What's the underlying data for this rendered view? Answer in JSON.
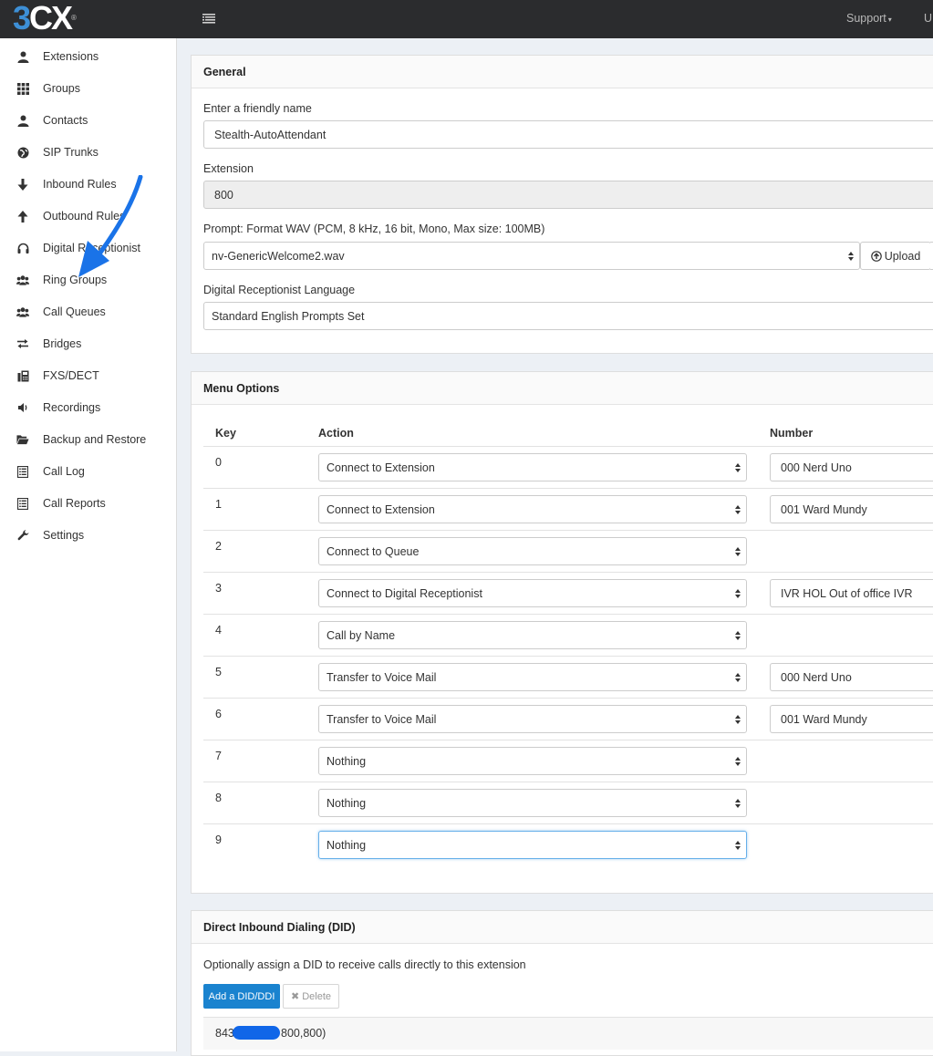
{
  "header": {
    "logo_digit": "3",
    "logo_letters": "CX",
    "logo_reg": "®",
    "support_label": "Support",
    "user_initial": "U"
  },
  "colors": {
    "topbar": "#2b2c2e",
    "logo_blue": "#3d8fd6",
    "primary_button": "#1a83cf",
    "annotation_arrow": "#1a73e8"
  },
  "sidebar": {
    "items": [
      {
        "label": "Extensions",
        "icon": "user-icon"
      },
      {
        "label": "Groups",
        "icon": "grid-icon"
      },
      {
        "label": "Contacts",
        "icon": "user-icon"
      },
      {
        "label": "SIP Trunks",
        "icon": "globe-icon"
      },
      {
        "label": "Inbound Rules",
        "icon": "arrow-down-icon"
      },
      {
        "label": "Outbound Rules",
        "icon": "arrow-up-icon"
      },
      {
        "label": "Digital Receptionist",
        "icon": "headset-icon"
      },
      {
        "label": "Ring Groups",
        "icon": "users-icon"
      },
      {
        "label": "Call Queues",
        "icon": "users-icon"
      },
      {
        "label": "Bridges",
        "icon": "exchange-icon"
      },
      {
        "label": "FXS/DECT",
        "icon": "fax-icon"
      },
      {
        "label": "Recordings",
        "icon": "volume-icon"
      },
      {
        "label": "Backup and Restore",
        "icon": "folder-open-icon"
      },
      {
        "label": "Call Log",
        "icon": "list-icon"
      },
      {
        "label": "Call Reports",
        "icon": "list-icon"
      },
      {
        "label": "Settings",
        "icon": "wrench-icon"
      }
    ]
  },
  "general": {
    "title": "General",
    "friendly_name_label": "Enter a friendly name",
    "friendly_name_value": "Stealth-AutoAttendant",
    "extension_label": "Extension",
    "extension_value": "800",
    "prompt_label": "Prompt: Format WAV (PCM, 8 kHz, 16 bit, Mono, Max size: 100MB)",
    "prompt_value": "nv-GenericWelcome2.wav",
    "upload_label": "Upload",
    "language_label": "Digital Receptionist Language",
    "language_value": "Standard English Prompts Set"
  },
  "menu": {
    "title": "Menu Options",
    "col_key": "Key",
    "col_action": "Action",
    "col_number": "Number",
    "rows": [
      {
        "key": "0",
        "action": "Connect to Extension",
        "number": "000 Nerd Uno"
      },
      {
        "key": "1",
        "action": "Connect to Extension",
        "number": "001 Ward Mundy"
      },
      {
        "key": "2",
        "action": "Connect to Queue",
        "number": ""
      },
      {
        "key": "3",
        "action": "Connect to Digital Receptionist",
        "number": "IVR HOL Out of office IVR"
      },
      {
        "key": "4",
        "action": "Call by Name",
        "number": ""
      },
      {
        "key": "5",
        "action": "Transfer to Voice Mail",
        "number": "000 Nerd Uno"
      },
      {
        "key": "6",
        "action": "Transfer to Voice Mail",
        "number": "001 Ward Mundy"
      },
      {
        "key": "7",
        "action": "Nothing",
        "number": ""
      },
      {
        "key": "8",
        "action": "Nothing",
        "number": ""
      },
      {
        "key": "9",
        "action": "Nothing",
        "number": ""
      }
    ]
  },
  "did": {
    "title": "Direct Inbound Dialing (DID)",
    "description": "Optionally assign a DID to receive calls directly to this extension",
    "add_label": "Add a DID/DDI",
    "delete_label": "Delete",
    "entry_prefix": "843",
    "entry_suffix": "800,800)"
  }
}
